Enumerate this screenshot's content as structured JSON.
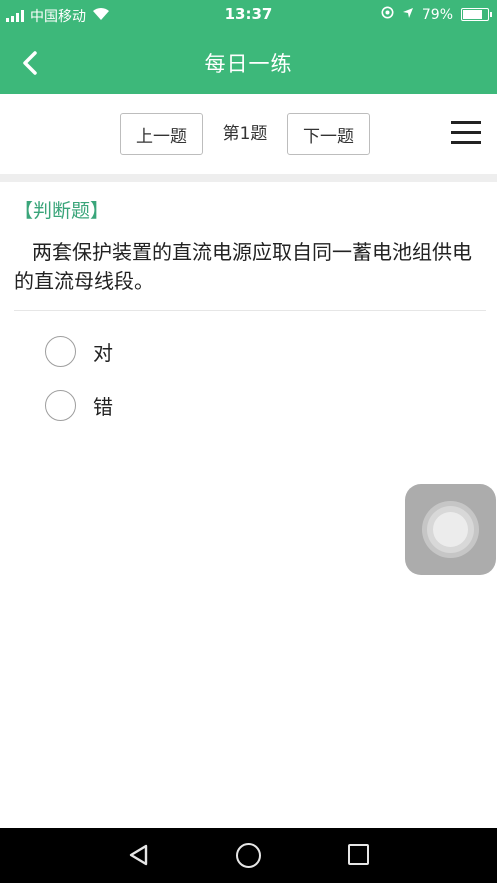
{
  "status_bar": {
    "carrier": "中国移动",
    "time": "13:37",
    "battery": "79%",
    "battery_level": 0.79
  },
  "header": {
    "title": "每日一练"
  },
  "toolbar": {
    "prev_label": "上一题",
    "page_label": "第1题",
    "next_label": "下一题"
  },
  "question": {
    "type_label": "【判断题】",
    "text": "两套保护装置的直流电源应取自同一蓄电池组供电的直流母线段。",
    "options": [
      {
        "label": "对"
      },
      {
        "label": "错"
      }
    ]
  },
  "colors": {
    "primary_green": "#3db87a",
    "type_label_green": "#3aa57a"
  },
  "icons": {
    "back": "chevron-left-icon",
    "menu": "hamburger-menu-icon",
    "nav_back": "triangle-back-icon",
    "nav_home": "circle-home-icon",
    "nav_recent": "square-recent-icon"
  }
}
